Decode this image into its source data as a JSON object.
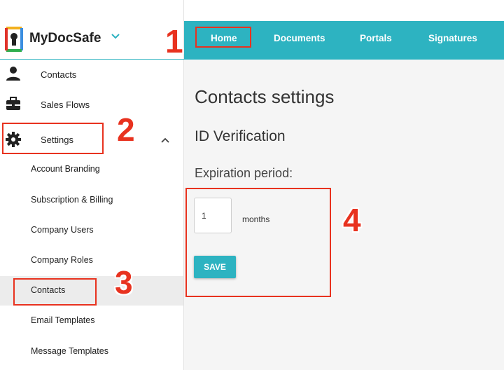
{
  "brand": {
    "name": "MyDocSafe",
    "logo_icon": "keyhole-logo-icon",
    "caret_icon": "chevron-down-icon",
    "accent": "#2db3c1"
  },
  "sidebar": {
    "items": [
      {
        "label": "Contacts",
        "icon": "person-icon"
      },
      {
        "label": "Sales Flows",
        "icon": "briefcase-icon"
      },
      {
        "label": "Settings",
        "icon": "gear-icon",
        "expanded": true
      }
    ],
    "submenu": [
      {
        "label": "Account Branding"
      },
      {
        "label": "Subscription & Billing"
      },
      {
        "label": "Company Users"
      },
      {
        "label": "Company Roles"
      },
      {
        "label": "Contacts",
        "active": true
      },
      {
        "label": "Email Templates"
      },
      {
        "label": "Message Templates"
      }
    ]
  },
  "topbar": {
    "tabs": [
      "Home",
      "Documents",
      "Portals",
      "Signatures"
    ]
  },
  "main": {
    "title": "Contacts settings",
    "section": "ID Verification",
    "field_label": "Expiration period:",
    "expiration_value": "1",
    "unit": "months",
    "save_label": "SAVE"
  },
  "annotations": {
    "color": "#e8321f",
    "labels": [
      "1",
      "2",
      "3",
      "4"
    ]
  }
}
